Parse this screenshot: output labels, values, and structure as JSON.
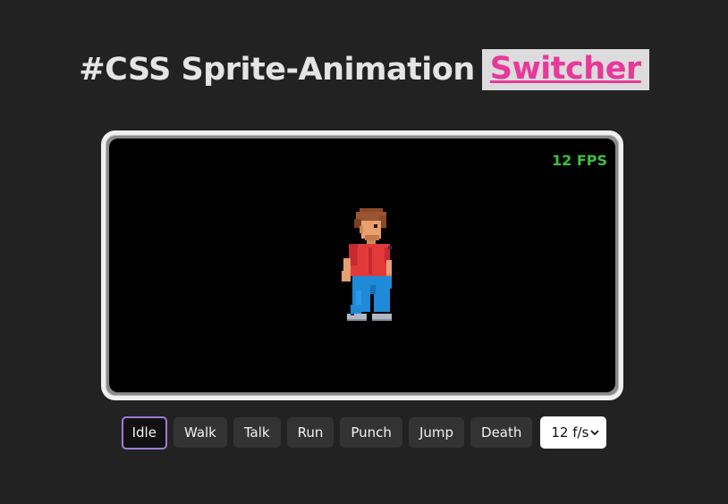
{
  "header": {
    "title": "#CSS Sprite-Animation",
    "link_label": "Switcher"
  },
  "stage": {
    "fps_label": "12 FPS",
    "character": "pixel-character-idle"
  },
  "controls": {
    "buttons": [
      "Idle",
      "Walk",
      "Talk",
      "Run",
      "Punch",
      "Jump",
      "Death"
    ],
    "active": "Idle",
    "speed_select": "12 f/s"
  },
  "colors": {
    "background": "#222222",
    "accent_link": "#e8389a",
    "fps_green": "#3fbf3f",
    "active_border": "#a07ad8"
  }
}
